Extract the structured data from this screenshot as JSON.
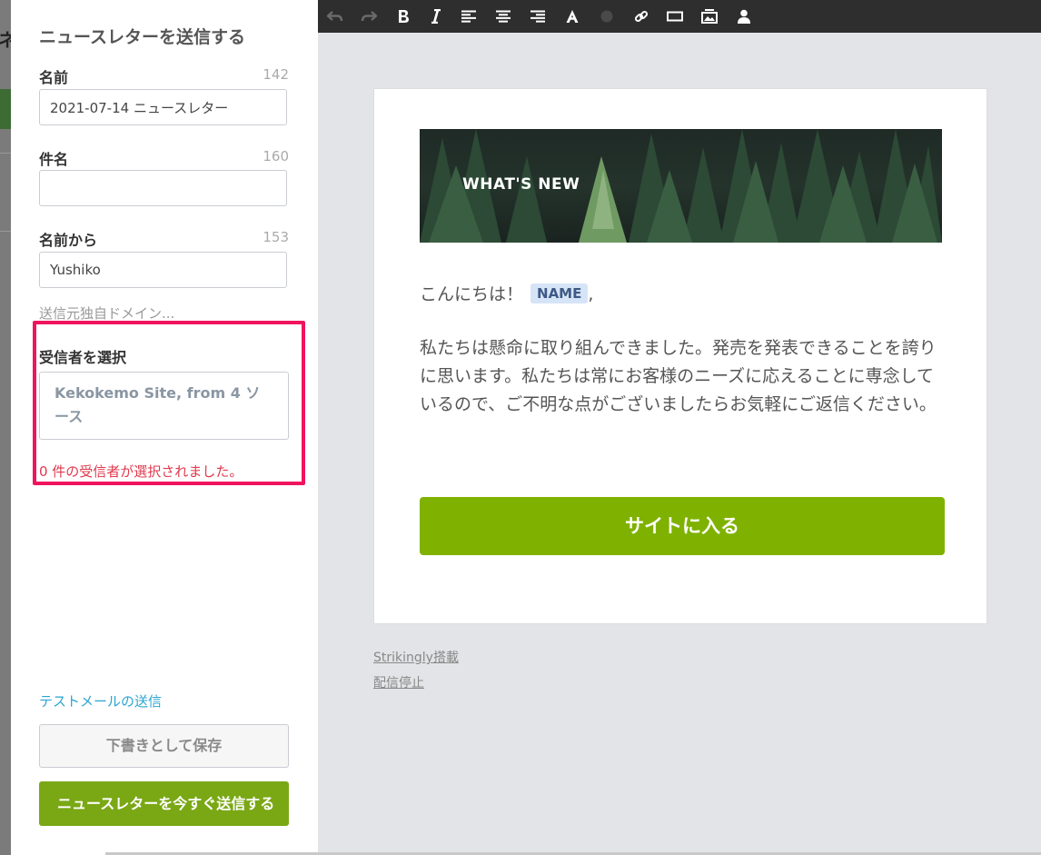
{
  "panel": {
    "title": "ニュースレターを送信する",
    "name_label": "名前",
    "name_count": "142",
    "name_value": "2021-07-14 ニュースレター",
    "subject_label": "件名",
    "subject_count": "160",
    "subject_value": "",
    "from_label": "名前から",
    "from_count": "153",
    "from_value": "Yushiko",
    "custom_domain": "送信元独自ドメイン...",
    "recipients_label": "受信者を選択",
    "recipients_value": "Kekokemo Site, from 4 ソース",
    "recipients_warning": "0 件の受信者が選択されました。",
    "test_mail": "テストメールの送信",
    "save_draft": "下書きとして保存",
    "send_now": "ニュースレターを今すぐ送信する"
  },
  "toolbar": {
    "icons": [
      "undo-icon",
      "redo-icon",
      "bold-icon",
      "italic-icon",
      "align-left-icon",
      "align-center-icon",
      "align-right-icon",
      "font-color-icon",
      "color-dot-icon",
      "link-icon",
      "button-icon",
      "image-icon",
      "user-icon"
    ]
  },
  "email": {
    "banner_text": "WHAT'S NEW",
    "greeting": "こんにちは！",
    "name_tag": "NAME",
    "greeting_comma": ",",
    "body": "私たちは懸命に取り組んできました。発売を発表できることを誇りに思います。私たちは常にお客様のニーズに応えることに専念しているので、ご不明な点がございましたらお気軽にご返信ください。",
    "cta": "サイトに入る"
  },
  "footer": {
    "powered_by": "Strikingly搭載",
    "unsubscribe": "配信停止"
  },
  "colors": {
    "send_button": "#7aa815",
    "cta_button": "#7fb200",
    "highlight": "#f0145f",
    "warning": "#e0394d",
    "link": "#2aa5d0"
  }
}
